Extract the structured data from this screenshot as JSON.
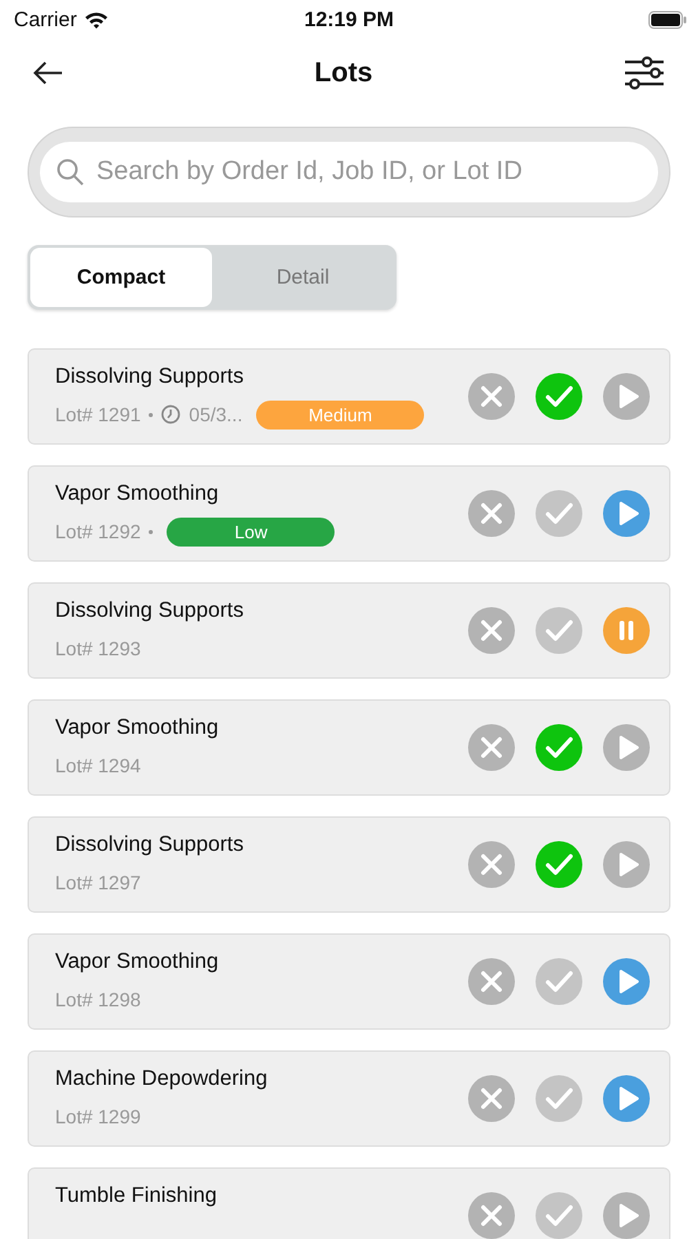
{
  "status_bar": {
    "carrier": "Carrier",
    "time": "12:19 PM"
  },
  "header": {
    "title": "Lots"
  },
  "search": {
    "placeholder": "Search by Order Id, Job ID, or Lot ID"
  },
  "view_tabs": [
    {
      "label": "Compact",
      "selected": true
    },
    {
      "label": "Detail",
      "selected": false
    }
  ],
  "lots": [
    {
      "title": "Dissolving Supports",
      "lot": "Lot# 1291",
      "date": "05/3...",
      "priority": {
        "label": "Medium",
        "color": "#fda53e"
      },
      "done": true,
      "active": false,
      "paused": false
    },
    {
      "title": "Vapor Smoothing",
      "lot": "Lot# 1292",
      "priority": {
        "label": "Low",
        "color": "#27a645"
      },
      "done": false,
      "active": true,
      "paused": false
    },
    {
      "title": "Dissolving Supports",
      "lot": "Lot# 1293",
      "done": false,
      "active": false,
      "paused": true
    },
    {
      "title": "Vapor Smoothing",
      "lot": "Lot# 1294",
      "done": true,
      "active": false,
      "paused": false
    },
    {
      "title": "Dissolving Supports",
      "lot": "Lot# 1297",
      "done": true,
      "active": false,
      "paused": false
    },
    {
      "title": "Vapor Smoothing",
      "lot": "Lot# 1298",
      "done": false,
      "active": true,
      "paused": false
    },
    {
      "title": "Machine Depowdering",
      "lot": "Lot# 1299",
      "done": false,
      "active": true,
      "paused": false
    },
    {
      "title": "Tumble Finishing",
      "done": false,
      "active": false,
      "paused": false
    }
  ]
}
